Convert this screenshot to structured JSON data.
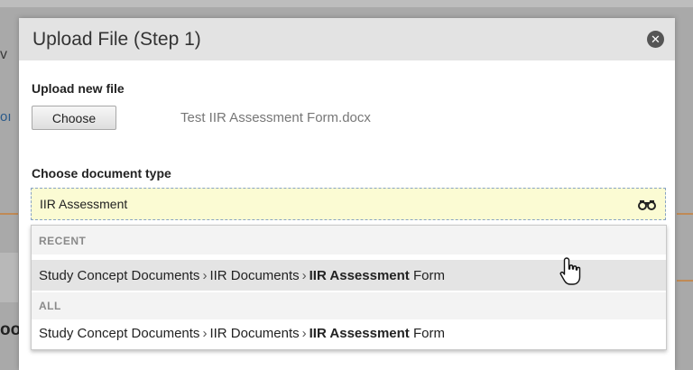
{
  "background": {
    "frag1": "v",
    "frag2": "oı",
    "frag3": "oo"
  },
  "dialog": {
    "title": "Upload File (Step 1)",
    "close_icon": "close-icon",
    "upload_label": "Upload new file",
    "choose_label": "Choose",
    "file_name": "Test IIR Assessment Form.docx",
    "doc_type_label": "Choose document type",
    "doc_type_value": "IIR Assessment",
    "search_icon": "binoculars-icon"
  },
  "dropdown": {
    "recent_header": "RECENT",
    "recent": [
      {
        "crumb1": "Study Concept Documents",
        "sep": "›",
        "crumb2": "IIR Documents",
        "match": "IIR Assessment",
        "rest": " Form"
      }
    ],
    "all_header": "ALL",
    "all": [
      {
        "crumb1": "Study Concept Documents",
        "sep": "›",
        "crumb2": "IIR Documents",
        "match": "IIR Assessment",
        "rest": " Form"
      }
    ]
  },
  "colors": {
    "input_bg": "#fbfbd3",
    "header_bg": "#e3e3e3",
    "accent_rule": "#c08a55"
  }
}
